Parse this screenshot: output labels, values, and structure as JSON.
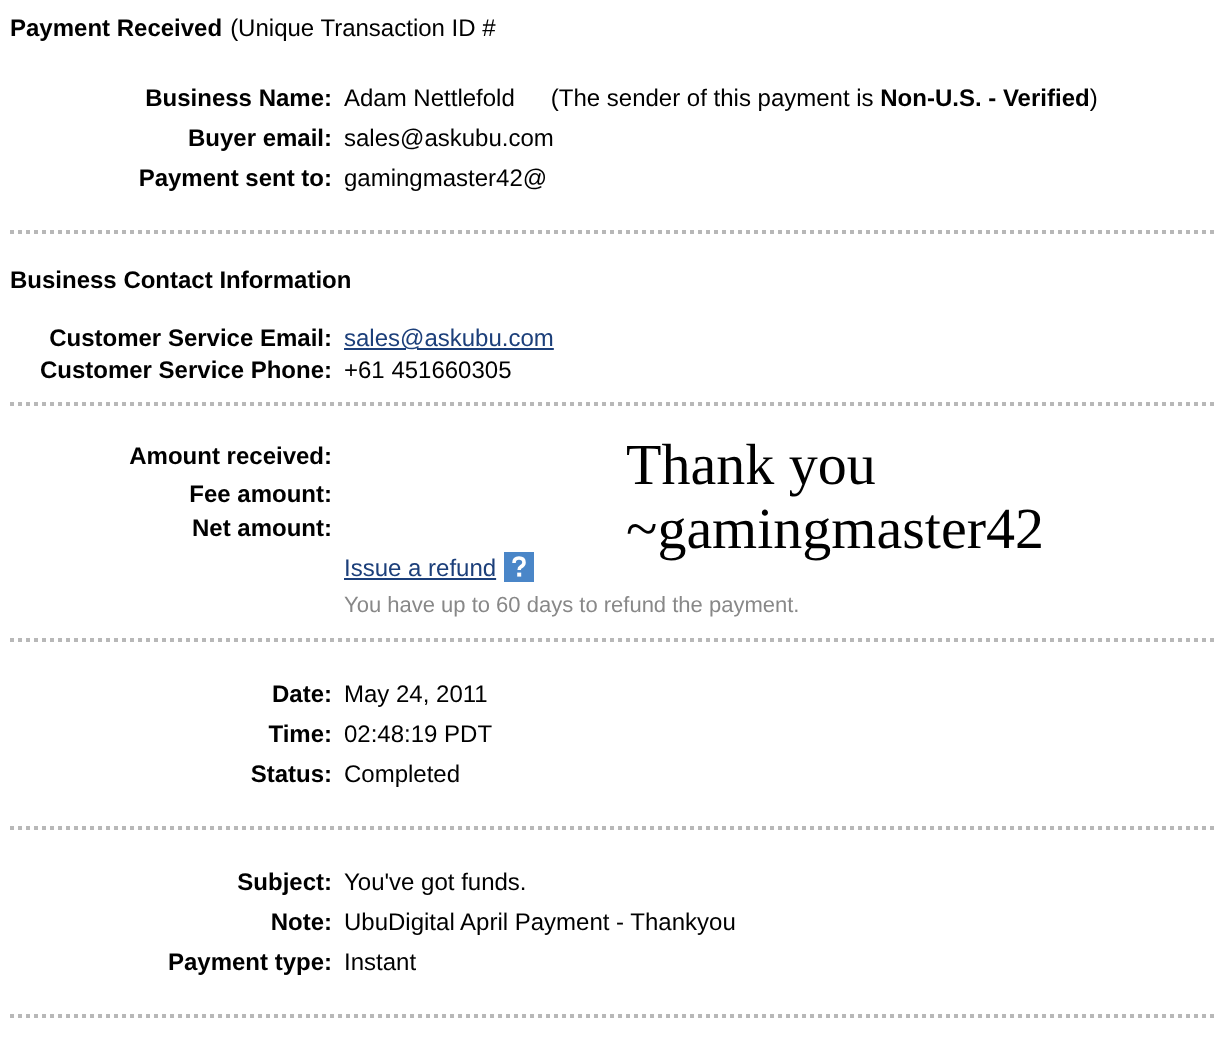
{
  "header": {
    "title": "Payment Received",
    "note": "(Unique Transaction ID #"
  },
  "sections": [
    {
      "kind": "details",
      "rows": [
        {
          "kind": "text",
          "label": "Business Name:",
          "value": "Adam Nettlefold",
          "extra": "(The sender of this payment is **Non-U.S. - Verified**)"
        },
        {
          "kind": "text",
          "label": "Buyer email:",
          "value": "sales@askubu.com"
        },
        {
          "kind": "text",
          "label": "Payment sent to:",
          "value": "gamingmaster42@"
        }
      ]
    },
    {
      "kind": "contact",
      "heading": "Business Contact Information",
      "rows": [
        {
          "kind": "link",
          "label": "Customer Service Email:",
          "value": "sales@askubu.com"
        },
        {
          "kind": "text",
          "label": "Customer Service Phone:",
          "value": "+61 451660305"
        }
      ]
    },
    {
      "kind": "amounts",
      "rows": [
        {
          "label": "Amount received:"
        },
        {
          "label": "Fee amount:"
        },
        {
          "label": "Net amount:"
        }
      ],
      "link": "Issue a refund",
      "hint": "You have up to 60 days to refund the payment.",
      "annotation": [
        "Thank you",
        "~gamingmaster42"
      ]
    },
    {
      "kind": "details",
      "rows": [
        {
          "kind": "text",
          "label": "Date:",
          "value": "May 24, 2011"
        },
        {
          "kind": "text",
          "label": "Time:",
          "value": "02:48:19 PDT"
        },
        {
          "kind": "text",
          "label": "Status:",
          "value": "Completed"
        }
      ]
    },
    {
      "kind": "details",
      "rows": [
        {
          "kind": "text",
          "label": "Subject:",
          "value": "You've got funds."
        },
        {
          "kind": "text",
          "label": "Note:",
          "value": "UbuDigital April Payment - Thankyou"
        },
        {
          "kind": "text",
          "label": "Payment type:",
          "value": "Instant"
        }
      ]
    }
  ]
}
